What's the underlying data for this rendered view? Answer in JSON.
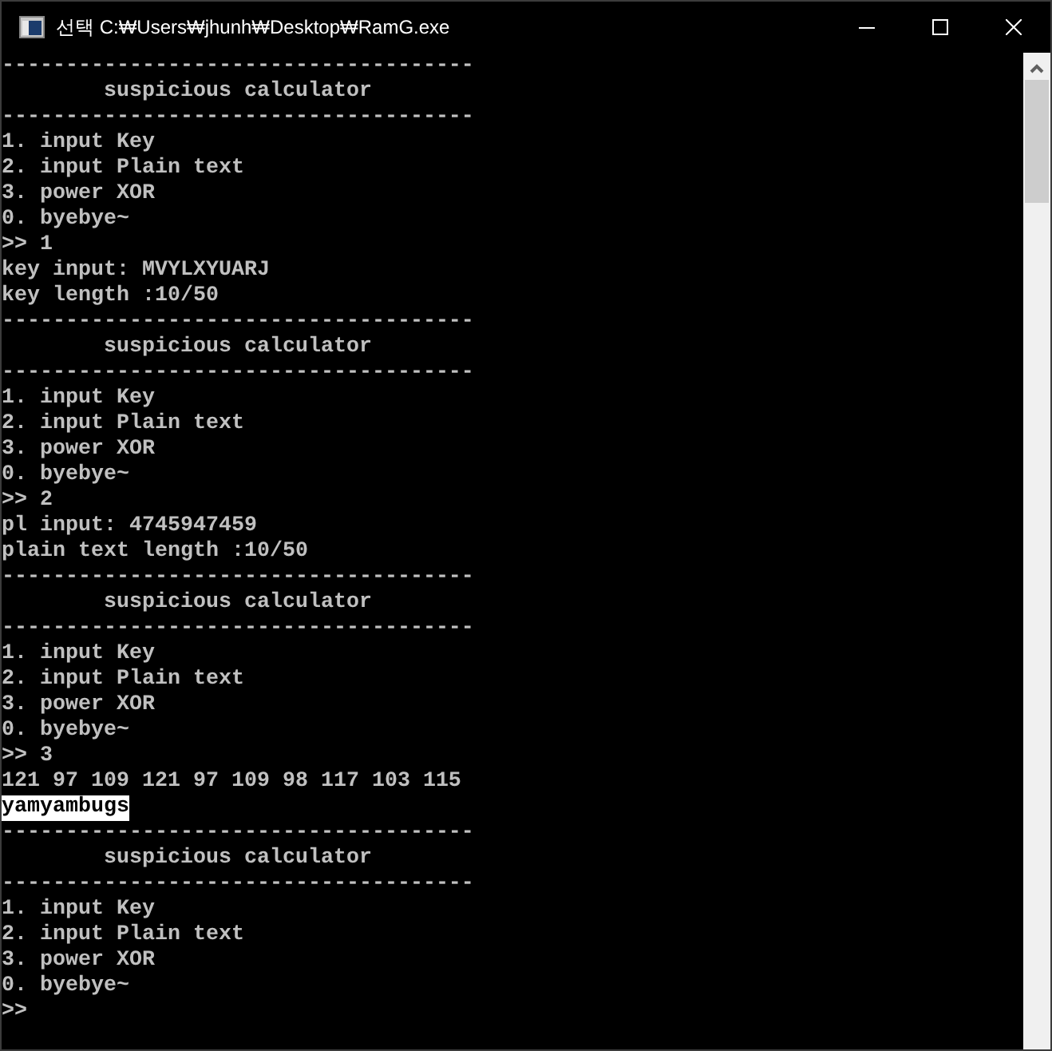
{
  "window": {
    "title": "선택 C:₩Users₩jhunh₩Desktop₩RamG.exe"
  },
  "console": {
    "lines": [
      {
        "text": "-------------------------------------",
        "selected": false
      },
      {
        "text": "        suspicious calculator",
        "selected": false
      },
      {
        "text": "-------------------------------------",
        "selected": false
      },
      {
        "text": "1. input Key",
        "selected": false
      },
      {
        "text": "2. input Plain text",
        "selected": false
      },
      {
        "text": "3. power XOR",
        "selected": false
      },
      {
        "text": "0. byebye~",
        "selected": false
      },
      {
        "text": ">> 1",
        "selected": false
      },
      {
        "text": "key input: MVYLXYUARJ",
        "selected": false
      },
      {
        "text": "key length :10/50",
        "selected": false
      },
      {
        "text": "-------------------------------------",
        "selected": false
      },
      {
        "text": "        suspicious calculator",
        "selected": false
      },
      {
        "text": "-------------------------------------",
        "selected": false
      },
      {
        "text": "1. input Key",
        "selected": false
      },
      {
        "text": "2. input Plain text",
        "selected": false
      },
      {
        "text": "3. power XOR",
        "selected": false
      },
      {
        "text": "0. byebye~",
        "selected": false
      },
      {
        "text": ">> 2",
        "selected": false
      },
      {
        "text": "pl input: 4745947459",
        "selected": false
      },
      {
        "text": "plain text length :10/50",
        "selected": false
      },
      {
        "text": "-------------------------------------",
        "selected": false
      },
      {
        "text": "        suspicious calculator",
        "selected": false
      },
      {
        "text": "-------------------------------------",
        "selected": false
      },
      {
        "text": "1. input Key",
        "selected": false
      },
      {
        "text": "2. input Plain text",
        "selected": false
      },
      {
        "text": "3. power XOR",
        "selected": false
      },
      {
        "text": "0. byebye~",
        "selected": false
      },
      {
        "text": ">> 3",
        "selected": false
      },
      {
        "text": "121 97 109 121 97 109 98 117 103 115",
        "selected": false
      },
      {
        "text": "yamyambugs",
        "selected": true
      },
      {
        "text": "-------------------------------------",
        "selected": false
      },
      {
        "text": "        suspicious calculator",
        "selected": false
      },
      {
        "text": "-------------------------------------",
        "selected": false
      },
      {
        "text": "1. input Key",
        "selected": false
      },
      {
        "text": "2. input Plain text",
        "selected": false
      },
      {
        "text": "3. power XOR",
        "selected": false
      },
      {
        "text": "0. byebye~",
        "selected": false
      },
      {
        "text": ">>",
        "selected": false
      }
    ]
  }
}
